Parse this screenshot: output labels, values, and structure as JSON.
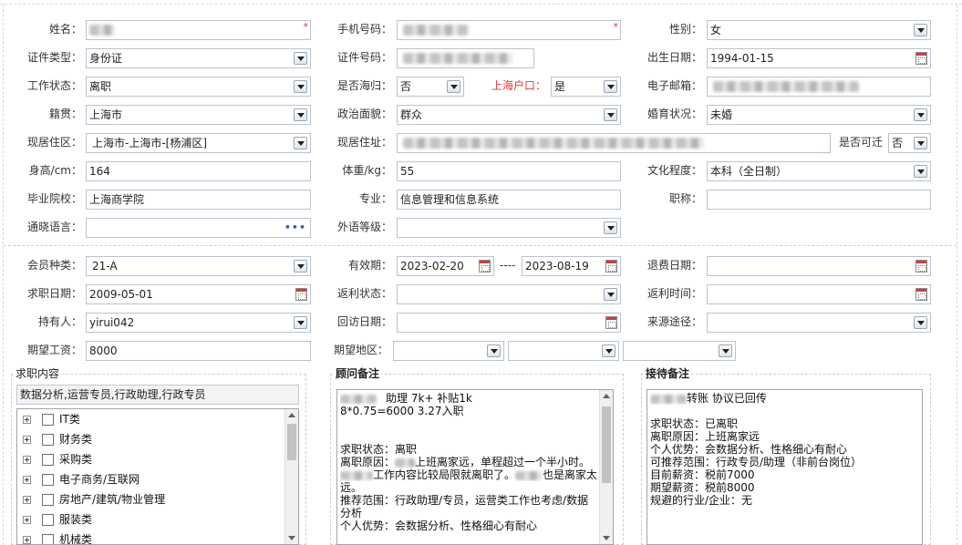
{
  "profile": {
    "name_label": "姓名：",
    "phone_label": "手机号码：",
    "gender_label": "性别：",
    "gender_value": "女",
    "id_type_label": "证件类型：",
    "id_type_value": "身份证",
    "id_no_label": "证件号码：",
    "birth_label": "出生日期：",
    "birth_value": "1994-01-15",
    "work_status_label": "工作状态：",
    "work_status_value": "离职",
    "returnee_label": "是否海归：",
    "returnee_value": "否",
    "shanghai_hukou_label": "上海户口：",
    "shanghai_hukou_value": "是",
    "email_label": "电子邮箱：",
    "native_label": "籍贯：",
    "native_value": "上海市",
    "political_label": "政治面貌：",
    "political_value": "群众",
    "marital_label": "婚育状况：",
    "marital_value": "未婚",
    "residence_area_label": "现居住区：",
    "residence_area_value": "上海市-上海市-[杨浦区]",
    "address_label": "现居住址：",
    "relocate_label": "是否可迁",
    "relocate_value": "否",
    "height_label": "身高/cm：",
    "height_value": "164",
    "weight_label": "体重/kg：",
    "weight_value": "55",
    "education_label": "文化程度：",
    "education_value": "本科（全日制）",
    "school_label": "毕业院校：",
    "school_value": "上海商学院",
    "major_label": "专业：",
    "major_value": "信息管理和信息系统",
    "title_label": "职称：",
    "language_label": "通晓语言：",
    "foreign_level_label": "外语等级："
  },
  "membership": {
    "type_label": "会员种类：",
    "type_value": "21-A",
    "valid_label": "有效期：",
    "valid_from": "2023-02-20",
    "valid_sep": "----",
    "valid_to": "2023-08-19",
    "refund_date_label": "退费日期：",
    "job_date_label": "求职日期：",
    "job_date_value": "2009-05-01",
    "rebate_status_label": "返利状态：",
    "rebate_time_label": "返利时间：",
    "holder_label": "持有人：",
    "holder_value": "yirui042",
    "visit_date_label": "回访日期：",
    "source_label": "来源途径：",
    "expected_salary_label": "期望工资：",
    "expected_salary_value": "8000",
    "expected_area_label": "期望地区："
  },
  "job_content": {
    "title": "求职内容",
    "summary": "数据分析,运营专员,行政助理,行政专员",
    "categories": [
      "IT类",
      "财务类",
      "采购类",
      "电子商务/互联网",
      "房地产/建筑/物业管理",
      "服装类",
      "机械类"
    ]
  },
  "consultant_notes": {
    "title": "顾问备注",
    "lines": [
      "助理  7k+ 补贴1k",
      "8*0.75=6000   3.27入职",
      "",
      "",
      "求职状态：离职",
      "离职原因：",
      "上班离家远，单程超过一个半小时。",
      "工作内容比较局限就离职了。",
      "也是离家太",
      "远。",
      "推荐范围：行政助理/专员，运营类工作也考虑/数据分析",
      "个人优势：会数据分析、性格细心有耐心"
    ]
  },
  "reception_notes": {
    "title": "接待备注",
    "lines": [
      "转账 协议已回传",
      "",
      "求职状态：已离职",
      "离职原因：上班离家远",
      "个人优势：会数据分析、性格细心有耐心",
      "可推荐范围：行政专员/助理（非前台岗位）",
      "目前薪资：税前7000",
      "期望薪资：税前8000",
      "规避的行业/企业：无"
    ]
  }
}
